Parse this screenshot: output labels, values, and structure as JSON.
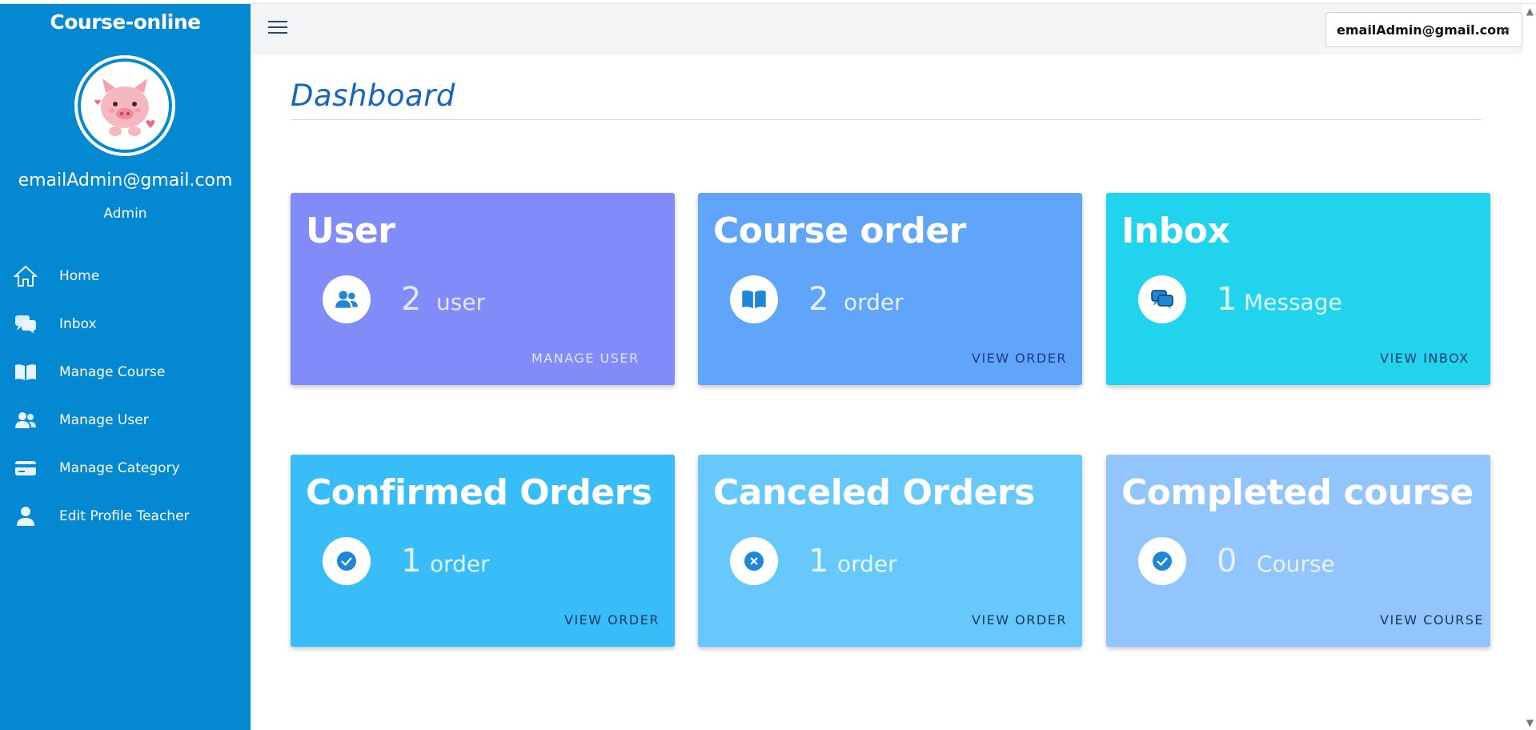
{
  "sidebar": {
    "brand": "Course-online",
    "email": "emailAdmin@gmail.com",
    "role": "Admin",
    "items": [
      {
        "label": "Home",
        "icon": "home-icon"
      },
      {
        "label": "Inbox",
        "icon": "chat-icon"
      },
      {
        "label": "Manage Course",
        "icon": "book-icon"
      },
      {
        "label": "Manage User",
        "icon": "users-icon"
      },
      {
        "label": "Manage Category",
        "icon": "card-icon"
      },
      {
        "label": "Edit Profile Teacher",
        "icon": "person-icon"
      }
    ]
  },
  "topbar": {
    "user_select": "emailAdmin@gmail.com"
  },
  "main": {
    "title": "Dashboard",
    "cards": [
      {
        "title": "User",
        "count": "2",
        "unit": "user",
        "action": "MANAGE USER",
        "icon": "users-icon",
        "color": "#818cf8",
        "count_color": "#e0e7ff",
        "action_color": "#e0e7ff"
      },
      {
        "title": "Course order",
        "count": "2",
        "unit": "order",
        "action": "VIEW ORDER",
        "icon": "book-icon",
        "color": "#60a5fa",
        "count_color": "#e6f0ff",
        "action_color": "#1e3a8a"
      },
      {
        "title": "Inbox",
        "count": "1",
        "unit": "Message",
        "action": "VIEW INBOX",
        "icon": "chat-icon",
        "color": "#22d3ee",
        "count_color": "#e0fbff",
        "action_color": "#1e3a6e"
      },
      {
        "title": "Confirmed Orders",
        "count": "1",
        "unit": "order",
        "action": "VIEW ORDER",
        "icon": "check-circle-icon",
        "color": "#38bdf8",
        "count_color": "#e0f4ff",
        "action_color": "#123a5e"
      },
      {
        "title": "Canceled Orders",
        "count": "1",
        "unit": "order",
        "action": "VIEW ORDER",
        "icon": "x-circle-icon",
        "color": "#67c8fb",
        "count_color": "#e6f7ff",
        "action_color": "#123a5e"
      },
      {
        "title": "Completed course",
        "count": "0",
        "unit": "Course",
        "action": "VIEW COURSE",
        "icon": "check-circle-icon",
        "color": "#93c5fd",
        "count_color": "#e8f2ff",
        "action_color": "#123a5e"
      }
    ]
  }
}
